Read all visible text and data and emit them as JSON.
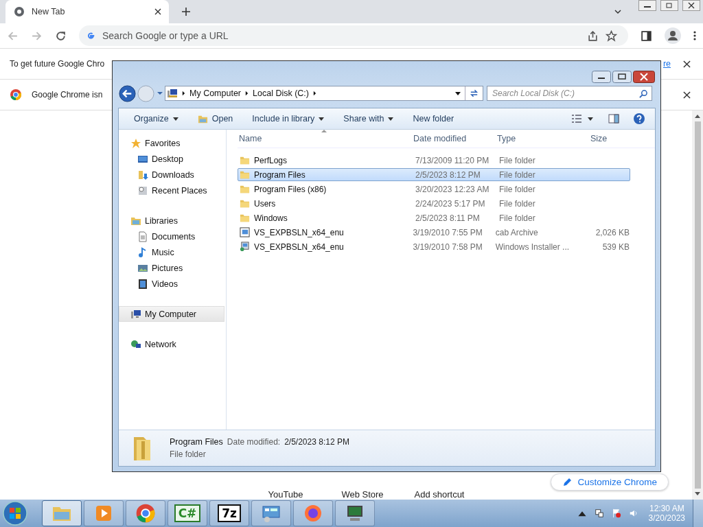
{
  "browser": {
    "tab": {
      "title": "New Tab"
    },
    "address": {
      "placeholder": "Search Google or type a URL"
    },
    "infobars": [
      {
        "text": "To get future Google Chro",
        "link": "re"
      },
      {
        "text": "Google Chrome isn"
      }
    ],
    "shortcuts": [
      "YouTube",
      "Web Store",
      "Add shortcut"
    ],
    "customize": "Customize Chrome"
  },
  "explorer": {
    "breadcrumb": [
      "My Computer",
      "Local Disk (C:)"
    ],
    "search": {
      "placeholder": "Search Local Disk (C:)"
    },
    "toolbar": [
      {
        "label": "Organize",
        "kind": "menu"
      },
      {
        "label": "Open",
        "kind": "open"
      },
      {
        "label": "Include in library",
        "kind": "menu"
      },
      {
        "label": "Share with",
        "kind": "menu"
      },
      {
        "label": "New folder",
        "kind": "plain"
      }
    ],
    "nav": [
      {
        "label": "Favorites",
        "kind": "star",
        "selected": false,
        "children": [
          {
            "label": "Desktop",
            "kind": "desktop",
            "selected": false
          },
          {
            "label": "Downloads",
            "kind": "downloads",
            "selected": false
          },
          {
            "label": "Recent Places",
            "kind": "recent",
            "selected": false
          }
        ]
      },
      {
        "label": "Libraries",
        "kind": "libraries",
        "selected": false,
        "children": [
          {
            "label": "Documents",
            "kind": "documents",
            "selected": false
          },
          {
            "label": "Music",
            "kind": "music",
            "selected": false
          },
          {
            "label": "Pictures",
            "kind": "pictures",
            "selected": false
          },
          {
            "label": "Videos",
            "kind": "videos",
            "selected": false
          }
        ]
      },
      {
        "label": "My Computer",
        "kind": "computer",
        "selected": true
      },
      {
        "label": "Network",
        "kind": "network",
        "selected": false
      }
    ],
    "columns": [
      "Name",
      "Date modified",
      "Type",
      "Size"
    ],
    "rows": [
      {
        "name": "PerfLogs",
        "date": "7/13/2009 11:20 PM",
        "type": "File folder",
        "kind": "folder",
        "selected": false
      },
      {
        "name": "Program Files",
        "date": "2/5/2023 8:12 PM",
        "type": "File folder",
        "kind": "folder",
        "selected": true
      },
      {
        "name": "Program Files (x86)",
        "date": "3/20/2023 12:23 AM",
        "type": "File folder",
        "kind": "folder",
        "selected": false
      },
      {
        "name": "Users",
        "date": "2/24/2023 5:17 PM",
        "type": "File folder",
        "kind": "folder",
        "selected": false
      },
      {
        "name": "Windows",
        "date": "2/5/2023 8:11 PM",
        "type": "File folder",
        "kind": "folder",
        "selected": false
      },
      {
        "name": "VS_EXPBSLN_x64_enu",
        "date": "3/19/2010 7:55 PM",
        "type": "cab Archive",
        "size": "2,026 KB",
        "kind": "cab",
        "selected": false
      },
      {
        "name": "VS_EXPBSLN_x64_enu",
        "date": "3/19/2010 7:58 PM",
        "type": "Windows Installer ...",
        "size": "539 KB",
        "kind": "installer",
        "selected": false
      }
    ],
    "details": {
      "name": "Program Files",
      "label": "Date modified:",
      "value": "2/5/2023 8:12 PM",
      "type": "File folder"
    }
  },
  "taskbar": {
    "apps": [
      {
        "kind": "explorer",
        "selected": true
      },
      {
        "kind": "media",
        "selected": false
      },
      {
        "kind": "chrome",
        "selected": false
      },
      {
        "kind": "csharp",
        "glyph": "C#",
        "selected": false
      },
      {
        "kind": "sevenzip",
        "glyph": "7z",
        "selected": false
      },
      {
        "kind": "control",
        "selected": false
      },
      {
        "kind": "firefox",
        "selected": false
      },
      {
        "kind": "monitor",
        "selected": false
      }
    ],
    "time": "12:30 AM",
    "date": "3/20/2023"
  }
}
